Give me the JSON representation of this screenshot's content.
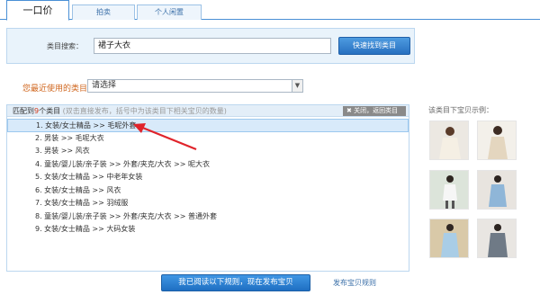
{
  "tabs": [
    {
      "label": "一口价",
      "active": true
    },
    {
      "label": "拍卖",
      "active": false
    },
    {
      "label": "个人闲置",
      "active": false
    }
  ],
  "search": {
    "label": "类目搜索：",
    "value": "裙子大衣",
    "button": "快速找到类目"
  },
  "recent": {
    "label": "您最近使用的类目：",
    "value": "请选择"
  },
  "results": {
    "title_prefix": "匹配到",
    "count": "9",
    "title_suffix": "个类目",
    "note": "(双击直接发布，括号中为该类目下相关宝贝的数量)",
    "close_label": "关闭，返回类目",
    "items": [
      "1.  女装/女士精品 >> 毛呢外套",
      "2.  男装 >> 毛呢大衣",
      "3.  男装 >> 风衣",
      "4.  童装/婴儿装/亲子装 >> 外套/夹克/大衣 >> 呢大衣",
      "5.  女装/女士精品 >> 中老年女装",
      "6.  女装/女士精品 >> 风衣",
      "7.  女装/女士精品 >> 羽绒服",
      "8.  童装/婴儿装/亲子装 >> 外套/夹克/大衣 >> 普通外套",
      "9.  女装/女士精品 >> 大码女装"
    ],
    "selected_index": 0
  },
  "confirm": {
    "button": "我已阅读以下规则，现在发布宝贝",
    "rules_link": "发布宝贝规则"
  },
  "examples": {
    "title": "该类目下宝贝示例：",
    "images": [
      "coat-photo-1",
      "coat-photo-2",
      "coat-photo-3",
      "coat-photo-4",
      "coat-photo-5",
      "coat-photo-6"
    ]
  },
  "colors": {
    "accent": "#2870c0",
    "annotation": "#e0242b",
    "count": "#d23b1c",
    "recent_label": "#d0671f"
  }
}
